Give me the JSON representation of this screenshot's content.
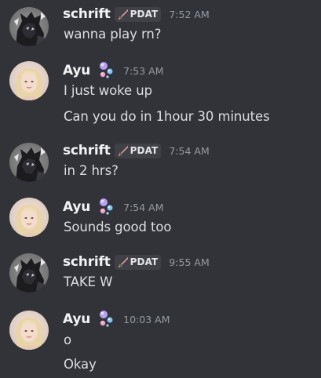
{
  "colors": {
    "background": "#313338",
    "username": "#f2f3f5",
    "message_text": "#dbdee1",
    "timestamp": "#949ba4",
    "tag_background": "#3f4147"
  },
  "users": {
    "schrift": {
      "name": "schrift",
      "tag": "PDAT",
      "tag_icon": "sword-icon",
      "avatar": "dark-armored-character-avatar"
    },
    "ayu": {
      "name": "Ayu",
      "badge_icon": "bubbles-icon",
      "avatar": "blonde-woman-avatar"
    }
  },
  "messages": [
    {
      "author": "schrift",
      "time": "7:52 AM",
      "lines": [
        "wanna play rn?"
      ]
    },
    {
      "author": "Ayu",
      "time": "7:53 AM",
      "lines": [
        "I just woke up",
        "Can you do in 1hour 30 minutes"
      ]
    },
    {
      "author": "schrift",
      "time": "7:54 AM",
      "lines": [
        "in 2 hrs?"
      ]
    },
    {
      "author": "Ayu",
      "time": "7:54 AM",
      "lines": [
        "Sounds good too"
      ]
    },
    {
      "author": "schrift",
      "time": "9:55 AM",
      "lines": [
        "TAKE W"
      ]
    },
    {
      "author": "Ayu",
      "time": "10:03 AM",
      "lines": [
        "o",
        "Okay"
      ]
    }
  ]
}
